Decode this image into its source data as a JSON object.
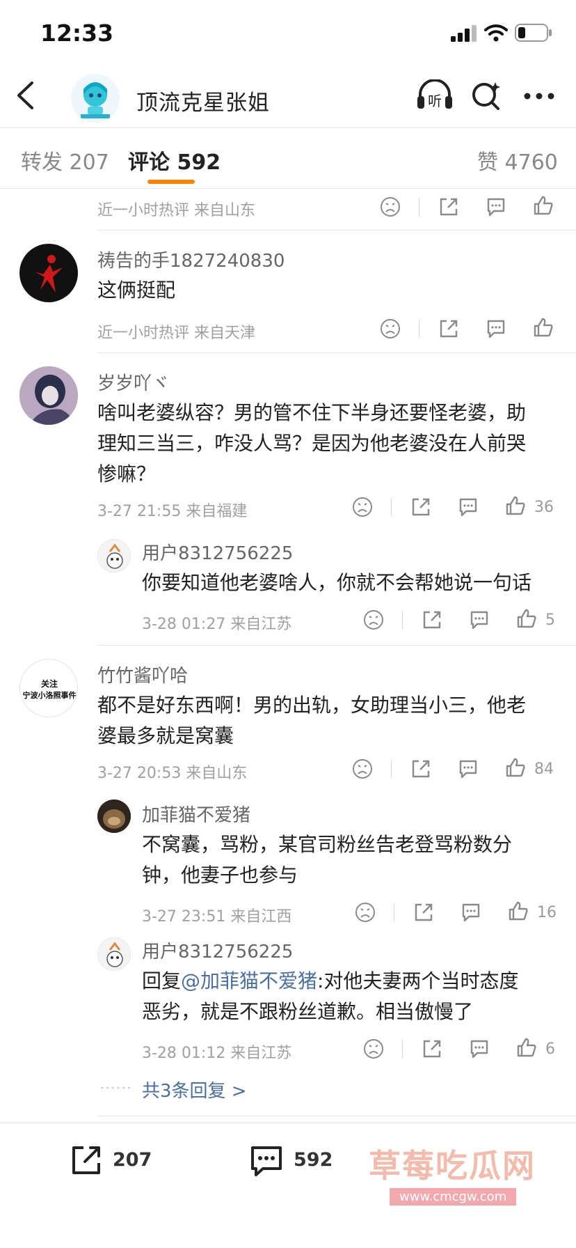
{
  "status_bar": {
    "time": "12:33"
  },
  "header": {
    "title": "顶流克星张姐"
  },
  "tabs": [
    {
      "label": "转发",
      "count": "207"
    },
    {
      "label": "评论",
      "count": "592"
    },
    {
      "label": "赞",
      "count": "4760"
    }
  ],
  "comments": [
    {
      "meta": "近一小时热评  来自山东"
    },
    {
      "name": "祷告的手1827240830",
      "text": "这俩挺配",
      "meta": "近一小时热评  来自天津"
    },
    {
      "name": "岁岁吖ヾ",
      "lines": [
        "啥叫老婆纵容？男的管不住下半身还要怪老婆，助",
        "理知三当三，咋没人骂？是因为他老婆没在人前哭",
        "惨嘛？"
      ],
      "meta": "3-27 21:55  来自福建",
      "likes": "36",
      "reply": {
        "name": "用户8312756225",
        "text": "你要知道他老婆啥人，你就不会帮她说一句话",
        "meta": "3-28 01:27  来自江苏",
        "likes": "5"
      }
    },
    {
      "avatar_text": [
        "关注",
        "宁波小洛照事件"
      ],
      "name": "竹竹酱吖哈",
      "lines": [
        "都不是好东西啊！男的出轨，女助理当小三，他老",
        "婆最多就是窝囊"
      ],
      "meta": "3-27 20:53  来自山东",
      "likes": "84",
      "replies": [
        {
          "name": "加菲猫不爱猪",
          "lines": [
            "不窝囊，骂粉，某官司粉丝告老登骂粉数分",
            "钟，他妻子也参与"
          ],
          "meta": "3-27 23:51  来自江西",
          "likes": "16"
        },
        {
          "name": "用户8312756225",
          "prefix": "回复",
          "mention": "@加菲猫不爱猪",
          "line1_rest": ":对他夫妻两个当时态度",
          "line2": "恶劣，就是不跟粉丝道歉。相当傲慢了",
          "meta": "3-28 01:12  来自江苏",
          "likes": "6"
        }
      ],
      "more_replies": "共3条回复 >"
    }
  ],
  "bottom_bar": {
    "repost_count": "207",
    "comment_count": "592"
  },
  "watermark": {
    "text": "草莓吃瓜网",
    "url": "www.cmcgw.com"
  }
}
